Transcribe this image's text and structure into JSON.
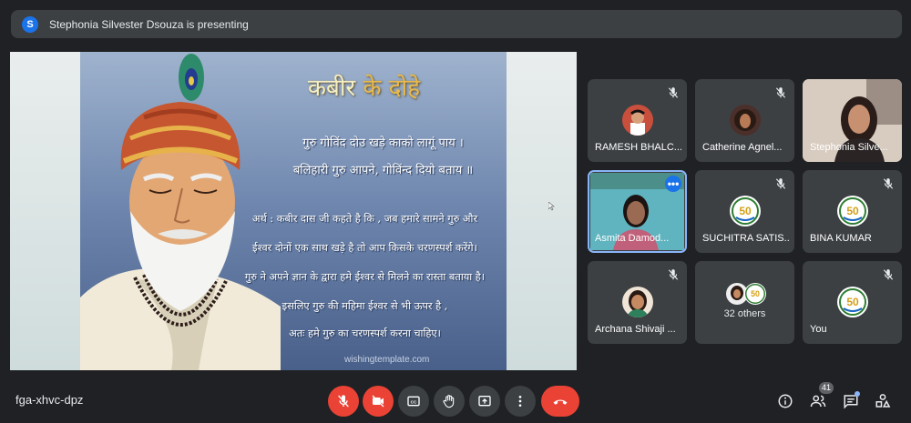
{
  "banner": {
    "avatar_letter": "S",
    "text": "Stephonia Silvester Dsouza is presenting"
  },
  "slide": {
    "title_part1": "कबीर ",
    "title_part2": "के दोहे",
    "couplet_line1": "गुरु गोविंद दोउ खड़े काको लागूं पाय ।",
    "couplet_line2": "बलिहारी गुरु आपने, गोविंन्द दियो बताय ॥",
    "meaning_lines": [
      "अर्थ : कबीर दास जी कहते है कि , जब हमारे सामने गुरु और",
      "ईश्वर दोनों एक साथ खड़े है तो आप किसके चरणस्पर्श करेंगे।",
      "गुरु ने अपने ज्ञान के द्वारा हमे ईश्वर से मिलने का रास्ता बताया है।",
      "इसलिए गुरु की महिमा ईश्वर से भी ऊपर है ,",
      "अतः हमे गुरु का चरणस्पर्श करना चाहिए।"
    ],
    "watermark": "wishingtemplate.com"
  },
  "participants": [
    {
      "name": "RAMESH BHALC...",
      "muted": true
    },
    {
      "name": "Catherine Agnel...",
      "muted": true
    },
    {
      "name": "Stephonia Silve...",
      "muted": false
    },
    {
      "name": "Asmita Damod...",
      "muted": false
    },
    {
      "name": "SUCHITRA SATIS...",
      "muted": true
    },
    {
      "name": "BINA KUMAR",
      "muted": true
    },
    {
      "name": "Archana Shivaji ...",
      "muted": true
    },
    {
      "name": "32 others",
      "muted": false
    },
    {
      "name": "You",
      "muted": true
    }
  ],
  "badge_text": "50",
  "bottom": {
    "meeting_code": "fga-xhvc-dpz",
    "people_count": "41"
  },
  "colors": {
    "background": "#202124",
    "tile": "#3c4043",
    "end_call": "#ea4335",
    "accent": "#1a73e8"
  },
  "icons": [
    "mic-off-icon",
    "camera-off-icon",
    "captions-icon",
    "raise-hand-icon",
    "present-icon",
    "more-options-icon",
    "end-call-icon",
    "info-icon",
    "people-icon",
    "chat-icon",
    "activities-icon"
  ]
}
